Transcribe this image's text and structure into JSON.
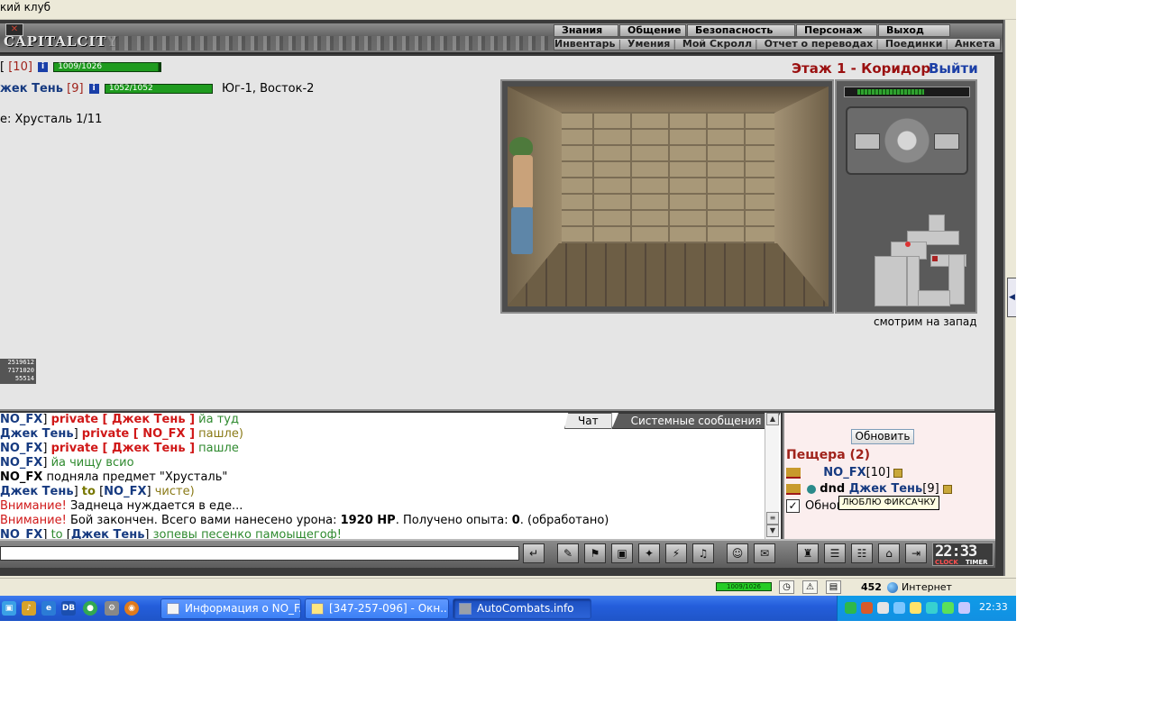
{
  "window": {
    "title": "кий клуб"
  },
  "topmenu": {
    "logo": "CAPITALCITY",
    "main": [
      "Знания",
      "Общение",
      "Безопасность",
      "Персонаж",
      "Выход"
    ],
    "sub": [
      "Инвентарь",
      "Умения",
      "Мой Скролл",
      "Отчет о переводах",
      "Поединки",
      "Анкета"
    ]
  },
  "players": {
    "self": {
      "name_fragment": "[",
      "level": "10",
      "hp_text": "1009/1026",
      "hp_fraction": 0.98
    },
    "other": {
      "name": "жек Тень",
      "level": "9",
      "hp_text": "1052/1052",
      "hp_fraction": 1.0,
      "coords": "Юг-1, Восток-2"
    },
    "quest": "е: Хрусталь 1/11"
  },
  "location": {
    "title": "Этаж 1 - Коридор",
    "exit": "Выйти",
    "looking": "смотрим на запад"
  },
  "counter": [
    "2519612",
    "7171020",
    "55514"
  ],
  "chat": {
    "tabs": [
      "Чат",
      "Системные сообщения"
    ],
    "lines": [
      {
        "parts": [
          {
            "t": "NO_FX",
            "c": "nick-b"
          },
          {
            "t": "] ",
            "c": ""
          },
          {
            "t": "private [ Джек Тень ]",
            "c": "priv"
          },
          {
            "t": " йа туд",
            "c": "msg-g"
          }
        ]
      },
      {
        "parts": [
          {
            "t": " ",
            "c": ""
          },
          {
            "t": "Джек Тень",
            "c": "nick-b"
          },
          {
            "t": "] ",
            "c": ""
          },
          {
            "t": "private [ NO_FX ]",
            "c": "priv"
          },
          {
            "t": " пашле)",
            "c": "msg-o"
          }
        ]
      },
      {
        "parts": [
          {
            "t": " ",
            "c": ""
          },
          {
            "t": "NO_FX",
            "c": "nick-b"
          },
          {
            "t": "] ",
            "c": ""
          },
          {
            "t": "private [ Джек Тень ]",
            "c": "priv"
          },
          {
            "t": " пашле",
            "c": "msg-g"
          }
        ]
      },
      {
        "parts": [
          {
            "t": " ",
            "c": ""
          },
          {
            "t": "NO_FX",
            "c": "nick-b"
          },
          {
            "t": "] ",
            "c": ""
          },
          {
            "t": "йа чищу всио",
            "c": "msg-g"
          }
        ]
      },
      {
        "parts": [
          {
            "t": "NO_FX",
            "c": "b"
          },
          {
            "t": " подняла предмет \"Хрусталь\"",
            "c": ""
          }
        ]
      },
      {
        "parts": [
          {
            "t": " ",
            "c": ""
          },
          {
            "t": "Джек Тень",
            "c": "nick-b"
          },
          {
            "t": "] ",
            "c": ""
          },
          {
            "t": "to",
            "c": "to"
          },
          {
            "t": " [",
            "c": ""
          },
          {
            "t": "NO_FX",
            "c": "nick-b"
          },
          {
            "t": "] ",
            "c": ""
          },
          {
            "t": "чисте)",
            "c": "msg-o"
          }
        ]
      },
      {
        "parts": [
          {
            "t": "Внимание!",
            "c": "warn"
          },
          {
            "t": " Заднеца нуждается в еде...",
            "c": ""
          }
        ]
      },
      {
        "parts": [
          {
            "t": "Внимание!",
            "c": "warn"
          },
          {
            "t": " Бой закончен. Всего вами нанесено урона: ",
            "c": ""
          },
          {
            "t": "1920 HP",
            "c": "b"
          },
          {
            "t": ". Получено опыта: ",
            "c": ""
          },
          {
            "t": "0",
            "c": "b"
          },
          {
            "t": ". (обработано)",
            "c": ""
          }
        ]
      },
      {
        "parts": [
          {
            "t": " ",
            "c": ""
          },
          {
            "t": "NO_FX",
            "c": "nick-b"
          },
          {
            "t": "] ",
            "c": ""
          },
          {
            "t": "to",
            "c": "msg-g"
          },
          {
            "t": " [",
            "c": ""
          },
          {
            "t": "Джек Тень",
            "c": "nick-b"
          },
          {
            "t": "] ",
            "c": ""
          },
          {
            "t": "зопевы песенко памоыщегоф!",
            "c": "msg-g"
          }
        ]
      }
    ]
  },
  "online": {
    "refresh": "Обновить",
    "room": "Пещера (2)",
    "users": [
      {
        "name": "NO_FX",
        "level": "[10]",
        "prefix": ""
      },
      {
        "name": "Джек Тень",
        "level": "[9]",
        "prefix": "dnd "
      }
    ],
    "autoupdate": "Обновлять автомат.",
    "tooltip": "ЛЮБЛЮ ФИКСАЧКУ",
    "checkbox_mark": "✓"
  },
  "toolbar": {
    "buttons": [
      "↵",
      "✎",
      "⚑",
      "▣",
      "✦",
      "⚡",
      "♫",
      "☺",
      "✉",
      "♜",
      "☰",
      "☷",
      "⌂",
      "⇥"
    ],
    "clock": "22:33",
    "clock_label": "CLOCK",
    "timer_label": "TIMER"
  },
  "statusbar": {
    "hp_text": "1009/1026",
    "num": "452",
    "zone": "Интернет"
  },
  "taskbar": {
    "tasks": [
      "Информация о NO_F...",
      "[347-257-096] - Окн...",
      "AutoCombats.info"
    ],
    "time": "22:33"
  },
  "colors": {
    "hp_green": "#1f9b1f",
    "alert_red": "#d01818",
    "nick_blue": "#163a80",
    "taskbar_blue": "#245edb"
  }
}
